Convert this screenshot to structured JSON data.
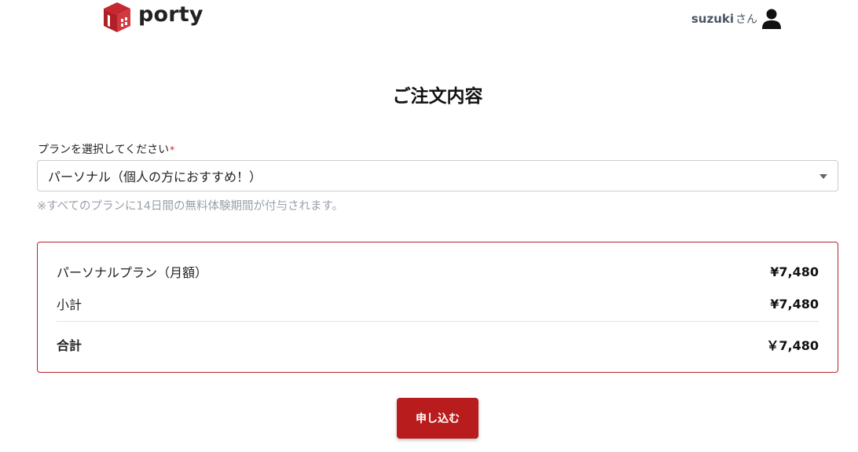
{
  "header": {
    "brand": "porty",
    "user_name": "suzuki",
    "user_suffix": "さん"
  },
  "page_title": "ご注文内容",
  "plan_field": {
    "label": "プランを選択してください",
    "required_mark": "*",
    "selected": "パーソナル（個人の方におすすめ！）",
    "note": "※すべてのプランに14日間の無料体験期間が付与されます。"
  },
  "summary": {
    "plan_label": "パーソナルプラン（月額）",
    "plan_price": "¥7,480",
    "subtotal_label": "小計",
    "subtotal_price": "¥7,480",
    "total_label": "合計",
    "total_price": "￥7,480"
  },
  "submit_label": "申し込む",
  "colors": {
    "accent": "#b91c1c",
    "summary_border": "#b1272d",
    "muted_text": "#9aa1ab"
  }
}
